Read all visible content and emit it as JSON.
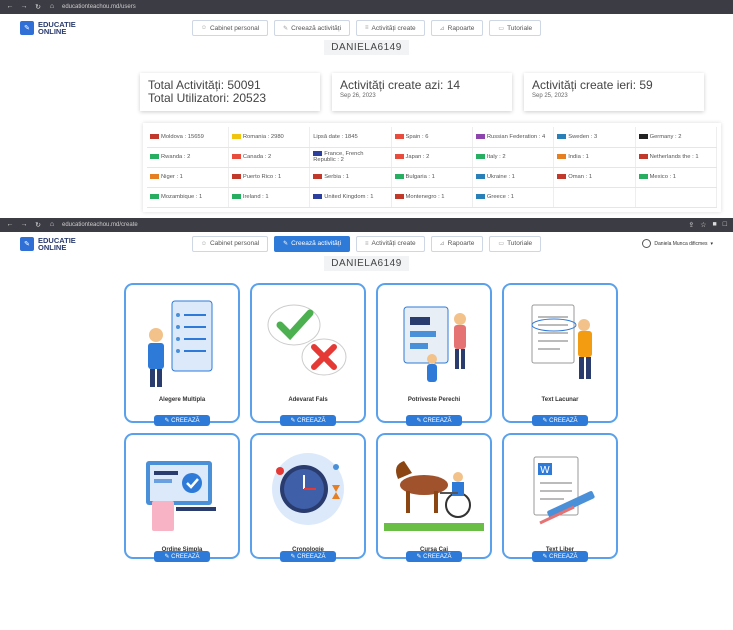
{
  "browser1": {
    "url": "educationteachou.md/users"
  },
  "browser2": {
    "url": "educationteachou.md/create"
  },
  "logo": {
    "line1": "EDUCATIE",
    "line2": "ONLINE"
  },
  "menu": [
    {
      "label": "Cabinet personal",
      "icon": "user-icon"
    },
    {
      "label": "Creează activități",
      "icon": "edit-icon"
    },
    {
      "label": "Activități create",
      "icon": "list-icon"
    },
    {
      "label": "Rapoarte",
      "icon": "chart-icon"
    },
    {
      "label": "Tutoriale",
      "icon": "video-icon"
    }
  ],
  "username": "DANIELA6149",
  "user_display": "Daniela Munca dificmes",
  "stats": {
    "total_activities": "Total Activități: 50091",
    "total_users": "Total Utilizatori: 20523",
    "today_label": "Activități create azi: 14",
    "today_date": "Sep 26, 2023",
    "yesterday_label": "Activități create ieri: 59",
    "yesterday_date": "Sep 25, 2023"
  },
  "countries": [
    [
      {
        "t": "Moldova : 15659",
        "f": "#c0392b"
      },
      {
        "t": "Romania : 2980",
        "f": "#f1c40f"
      },
      {
        "t": "Lipsă date : 1845",
        "f": ""
      },
      {
        "t": "Spain : 6",
        "f": "#e74c3c"
      },
      {
        "t": "Russian Federation : 4",
        "f": "#8e44ad"
      },
      {
        "t": "Sweden : 3",
        "f": "#2980b9"
      },
      {
        "t": "Germany : 2",
        "f": "#222"
      }
    ],
    [
      {
        "t": "Rwanda : 2",
        "f": "#27ae60"
      },
      {
        "t": "Canada : 2",
        "f": "#e74c3c"
      },
      {
        "t": "France, French Republic : 2",
        "f": "#2c3e9e"
      },
      {
        "t": "Japan : 2",
        "f": "#e74c3c"
      },
      {
        "t": "Italy : 2",
        "f": "#27ae60"
      },
      {
        "t": "India : 1",
        "f": "#e67e22"
      },
      {
        "t": "Netherlands the : 1",
        "f": "#c0392b"
      }
    ],
    [
      {
        "t": "Niger : 1",
        "f": "#e67e22"
      },
      {
        "t": "Puerto Rico : 1",
        "f": "#c0392b"
      },
      {
        "t": "Serbia : 1",
        "f": "#c0392b"
      },
      {
        "t": "Bulgaria : 1",
        "f": "#27ae60"
      },
      {
        "t": "Ukraine : 1",
        "f": "#2980b9"
      },
      {
        "t": "Oman : 1",
        "f": "#c0392b"
      },
      {
        "t": "Mexico : 1",
        "f": "#27ae60"
      }
    ],
    [
      {
        "t": "Mozambique : 1",
        "f": "#27ae60"
      },
      {
        "t": "Ireland : 1",
        "f": "#27ae60"
      },
      {
        "t": "United Kingdom : 1",
        "f": "#2c3e9e"
      },
      {
        "t": "Montenegro : 1",
        "f": "#c0392b"
      },
      {
        "t": "Greece : 1",
        "f": "#2980b9"
      },
      {
        "t": "",
        "f": ""
      },
      {
        "t": "",
        "f": ""
      }
    ]
  ],
  "cards": [
    {
      "title": "Alegere Multipla",
      "button": "CREEAZĂ"
    },
    {
      "title": "Adevarat Fals",
      "button": "CREEAZĂ"
    },
    {
      "title": "Potriveste Perechi",
      "button": "CREEAZĂ"
    },
    {
      "title": "Text Lacunar",
      "button": "CREEAZĂ"
    },
    {
      "title": "Ordine Simpla",
      "button": "CREEAZĂ"
    },
    {
      "title": "Cronologie",
      "button": "CREEAZĂ"
    },
    {
      "title": "Cursa Cai",
      "button": "CREEAZĂ"
    },
    {
      "title": "Text Liber",
      "button": "CREEAZĂ"
    }
  ]
}
